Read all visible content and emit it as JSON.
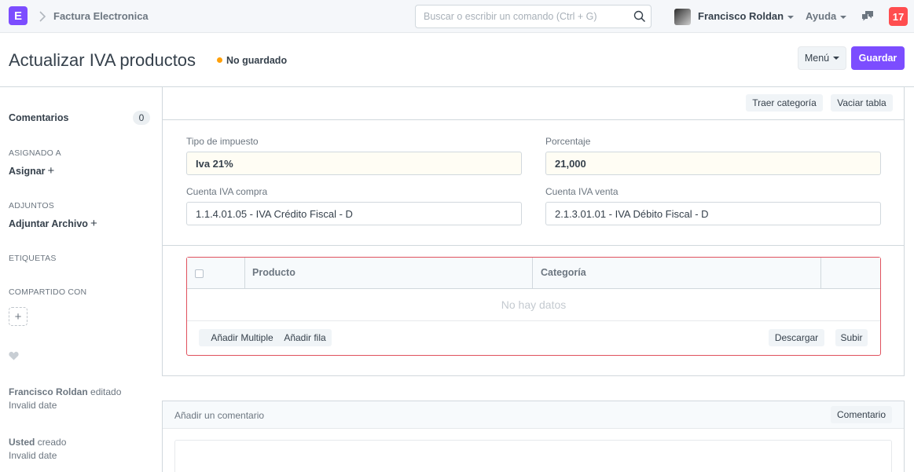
{
  "navbar": {
    "logo_letter": "E",
    "breadcrumb": "Factura Electronica",
    "search_placeholder": "Buscar o escribir un comando (Ctrl + G)",
    "user_name": "Francisco Roldan",
    "help_label": "Ayuda",
    "notification_count": "17"
  },
  "page": {
    "title": "Actualizar IVA productos",
    "status": "No guardado",
    "menu_label": "Menú",
    "save_label": "Guardar"
  },
  "sidebar": {
    "comments_label": "Comentarios",
    "comments_count": "0",
    "assigned_label": "ASIGNADO A",
    "assign_action": "Asignar",
    "attachments_label": "ADJUNTOS",
    "attach_action": "Adjuntar Archivo",
    "tags_label": "ETIQUETAS",
    "shared_label": "COMPARTIDO CON",
    "activity": [
      {
        "user": "Francisco Roldan",
        "action": "editado",
        "date": "Invalid date"
      },
      {
        "user": "Usted",
        "action": "creado",
        "date": "Invalid date"
      }
    ]
  },
  "form": {
    "toolbar": {
      "fetch_category": "Traer categoría",
      "clear_table": "Vaciar tabla"
    },
    "tax_type_label": "Tipo de impuesto",
    "tax_type_value": "Iva 21%",
    "percentage_label": "Porcentaje",
    "percentage_value": "21,000",
    "purchase_account_label": "Cuenta IVA compra",
    "purchase_account_value": "1.1.4.01.05 - IVA Crédito Fiscal - D",
    "sales_account_label": "Cuenta IVA venta",
    "sales_account_value": "2.1.3.01.01 - IVA Débito Fiscal - D"
  },
  "grid": {
    "columns": [
      "Producto",
      "Categoría"
    ],
    "empty_text": "No hay datos",
    "add_multiple": "Añadir Multiple",
    "add_row": "Añadir fila",
    "download": "Descargar",
    "upload": "Subir"
  },
  "comment": {
    "placeholder": "Añadir un comentario",
    "button": "Comentario"
  },
  "colors": {
    "primary": "#7c4dff",
    "notification": "#ff4d4f",
    "unsaved_indicator": "#ffa00a",
    "grid_border": "#e0525e"
  }
}
